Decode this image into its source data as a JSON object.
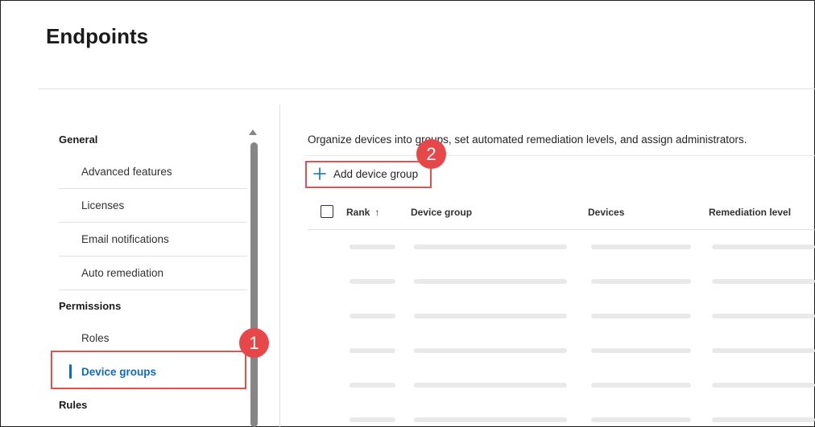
{
  "page": {
    "title": "Endpoints"
  },
  "nav": {
    "sections": [
      {
        "label": "General",
        "items": [
          "Advanced features",
          "Licenses",
          "Email notifications",
          "Auto remediation"
        ]
      },
      {
        "label": "Permissions",
        "items": [
          "Roles",
          "Device groups"
        ]
      },
      {
        "label": "Rules",
        "items": []
      }
    ],
    "selected_item": "Device groups"
  },
  "main": {
    "description": "Organize devices into groups, set automated remediation levels, and assign administrators.",
    "add_button_label": "Add device group",
    "table": {
      "columns": [
        "Rank",
        "Device group",
        "Devices",
        "Remediation level"
      ],
      "sort_column": "Rank",
      "sort_direction": "ascending",
      "loading_rows": 6
    }
  },
  "annotations": {
    "callout_1": "1",
    "callout_2": "2"
  },
  "colors": {
    "accent": "#0f6cbd",
    "callout": "#e8474a",
    "shimmer": "#e9e9e9",
    "divider": "#e1e1e1"
  }
}
